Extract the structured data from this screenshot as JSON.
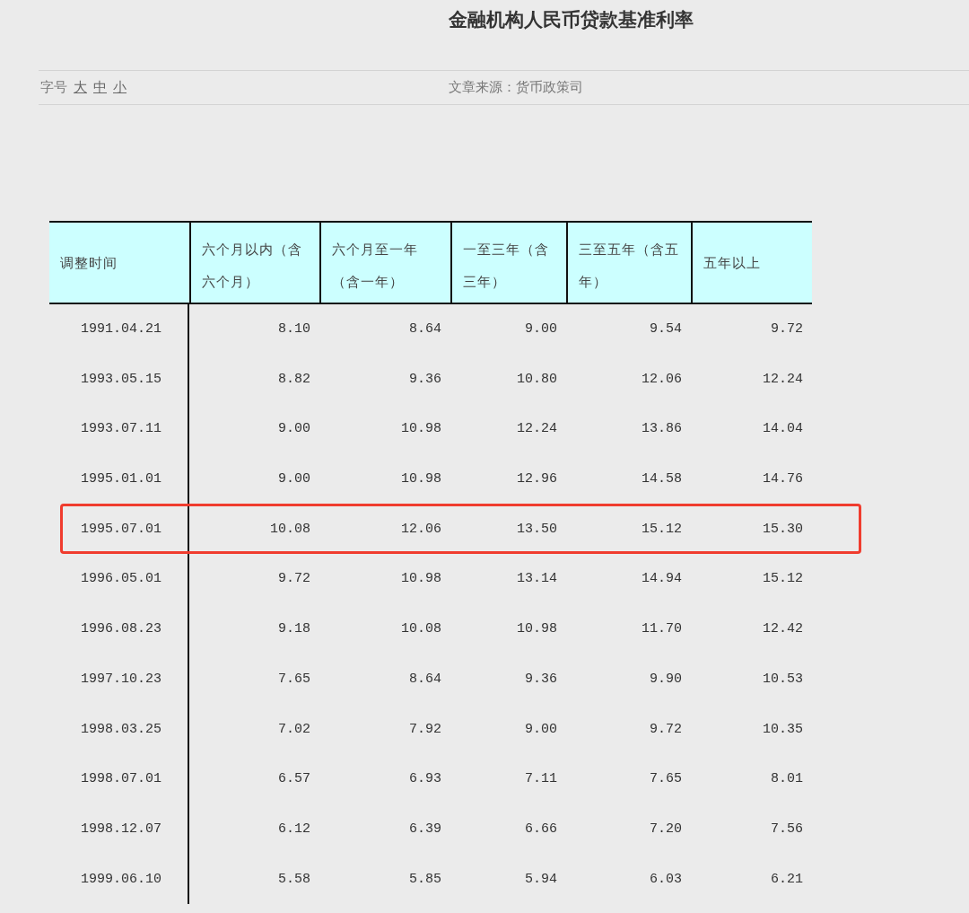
{
  "title": "金融机构人民币贷款基准利率",
  "font_size": {
    "label": "字号",
    "options": [
      {
        "label": "大"
      },
      {
        "label": "中"
      },
      {
        "label": "小"
      }
    ]
  },
  "source": "文章来源：货币政策司",
  "table": {
    "columns": [
      "调整时间",
      "六个月以内（含六个月）",
      "六个月至一年（含一年）",
      "一至三年（含三年）",
      "三至五年（含五年）",
      "五年以上"
    ],
    "rows": [
      {
        "cells": [
          "1991.04.21",
          "8.10",
          "8.64",
          "9.00",
          "9.54",
          "9.72"
        ],
        "highlighted": false
      },
      {
        "cells": [
          "1993.05.15",
          "8.82",
          "9.36",
          "10.80",
          "12.06",
          "12.24"
        ],
        "highlighted": false
      },
      {
        "cells": [
          "1993.07.11",
          "9.00",
          "10.98",
          "12.24",
          "13.86",
          "14.04"
        ],
        "highlighted": false
      },
      {
        "cells": [
          "1995.01.01",
          "9.00",
          "10.98",
          "12.96",
          "14.58",
          "14.76"
        ],
        "highlighted": false
      },
      {
        "cells": [
          "1995.07.01",
          "10.08",
          "12.06",
          "13.50",
          "15.12",
          "15.30"
        ],
        "highlighted": true
      },
      {
        "cells": [
          "1996.05.01",
          "9.72",
          "10.98",
          "13.14",
          "14.94",
          "15.12"
        ],
        "highlighted": false
      },
      {
        "cells": [
          "1996.08.23",
          "9.18",
          "10.08",
          "10.98",
          "11.70",
          "12.42"
        ],
        "highlighted": false
      },
      {
        "cells": [
          "1997.10.23",
          "7.65",
          "8.64",
          "9.36",
          "9.90",
          "10.53"
        ],
        "highlighted": false
      },
      {
        "cells": [
          "1998.03.25",
          "7.02",
          "7.92",
          "9.00",
          "9.72",
          "10.35"
        ],
        "highlighted": false
      },
      {
        "cells": [
          "1998.07.01",
          "6.57",
          "6.93",
          "7.11",
          "7.65",
          "8.01"
        ],
        "highlighted": false
      },
      {
        "cells": [
          "1998.12.07",
          "6.12",
          "6.39",
          "6.66",
          "7.20",
          "7.56"
        ],
        "highlighted": false
      },
      {
        "cells": [
          "1999.06.10",
          "5.58",
          "5.85",
          "5.94",
          "6.03",
          "6.21"
        ],
        "highlighted": false
      }
    ]
  }
}
